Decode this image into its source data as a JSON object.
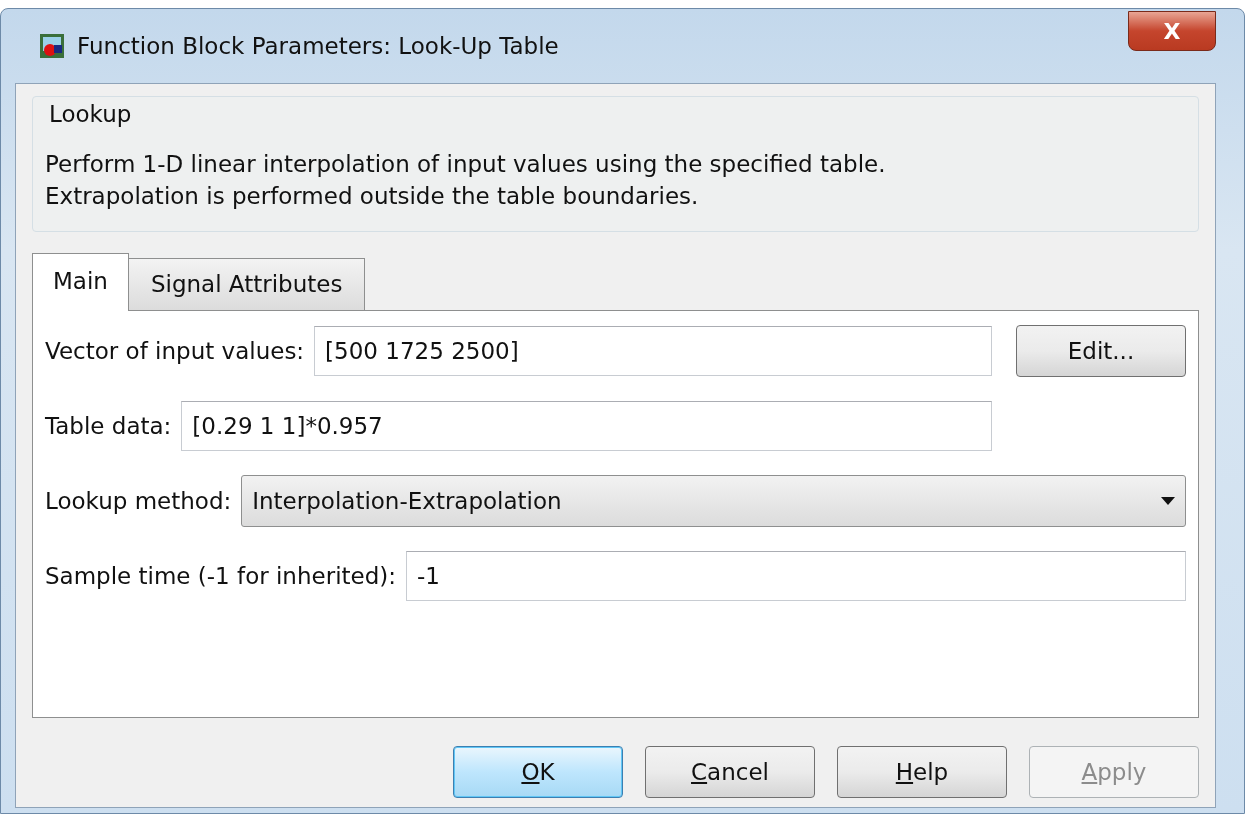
{
  "window": {
    "title": "Function Block Parameters: Look-Up Table",
    "close_label": "X"
  },
  "group": {
    "title": "Lookup",
    "description": "Perform 1-D linear interpolation of input values using the specified table.\nExtrapolation is performed outside the table boundaries."
  },
  "tabs": [
    {
      "label": "Main",
      "selected": true
    },
    {
      "label": "Signal Attributes",
      "selected": false
    }
  ],
  "fields": [
    {
      "kind": "text",
      "label": "Vector of input values:",
      "value": "[500 1725 2500]",
      "button": "Edit...",
      "wide": false
    },
    {
      "kind": "text",
      "label": "Table data:",
      "value": "[0.29 1 1]*0.957",
      "wide": false
    },
    {
      "kind": "select",
      "label": "Lookup method:",
      "value": "Interpolation-Extrapolation",
      "wide": true
    },
    {
      "kind": "text",
      "label": "Sample time (-1 for inherited):",
      "value": "-1",
      "wide": true
    }
  ],
  "buttons": [
    {
      "label": "OK",
      "default": true,
      "disabled": false,
      "mnemonic": true
    },
    {
      "label": "Cancel",
      "default": false,
      "disabled": false,
      "mnemonic": true
    },
    {
      "label": "Help",
      "default": false,
      "disabled": false,
      "mnemonic": true
    },
    {
      "label": "Apply",
      "default": false,
      "disabled": true,
      "mnemonic": true
    }
  ]
}
